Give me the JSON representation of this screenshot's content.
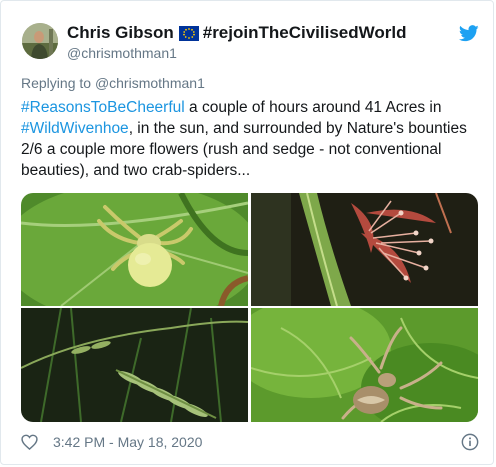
{
  "author": {
    "name": "Chris Gibson",
    "flag_icon": "eu-flag-icon",
    "tagline": "#rejoinTheCivilisedWorld",
    "handle": "@chrismothman1"
  },
  "reply": {
    "prefix": "Replying to",
    "to": "@chrismothman1"
  },
  "tweet": {
    "hashtag1": "#ReasonsToBeCheerful",
    "text1": " a couple of hours around 41 Acres in ",
    "hashtag2": "#WildWivenhoe",
    "text2": ", in the sun, and surrounded by Nature's bounties 2/6 a couple more flowers (rush and sedge - not conventional beauties), and two crab-spiders..."
  },
  "media": [
    {
      "icon": "yellow-crab-spider-photo"
    },
    {
      "icon": "rush-flower-photo"
    },
    {
      "icon": "sedge-grass-photo"
    },
    {
      "icon": "brown-crab-spider-photo"
    }
  ],
  "footer": {
    "timestamp": "3:42 PM - May 18, 2020",
    "like_icon": "heart-icon",
    "info_icon": "info-icon"
  },
  "colors": {
    "link": "#1b95e0",
    "twitter_blue": "#1da1f2",
    "muted": "#657786",
    "text": "#14171a"
  }
}
